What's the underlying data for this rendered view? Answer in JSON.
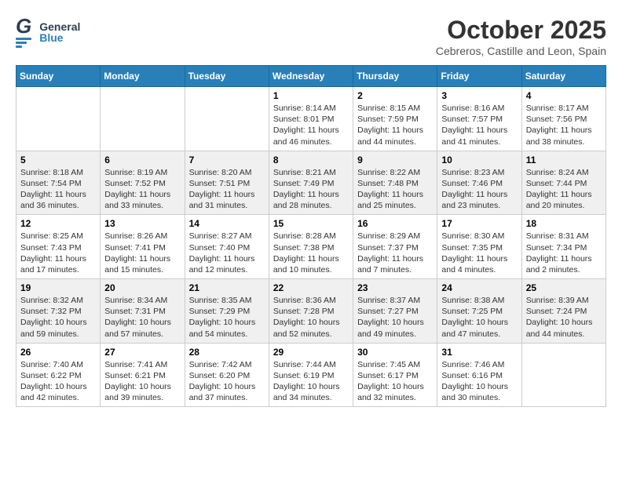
{
  "header": {
    "logo_general": "General",
    "logo_blue": "Blue",
    "month": "October 2025",
    "location": "Cebreros, Castille and Leon, Spain"
  },
  "weekdays": [
    "Sunday",
    "Monday",
    "Tuesday",
    "Wednesday",
    "Thursday",
    "Friday",
    "Saturday"
  ],
  "weeks": [
    [
      {
        "day": "",
        "info": ""
      },
      {
        "day": "",
        "info": ""
      },
      {
        "day": "",
        "info": ""
      },
      {
        "day": "1",
        "info": "Sunrise: 8:14 AM\nSunset: 8:01 PM\nDaylight: 11 hours\nand 46 minutes."
      },
      {
        "day": "2",
        "info": "Sunrise: 8:15 AM\nSunset: 7:59 PM\nDaylight: 11 hours\nand 44 minutes."
      },
      {
        "day": "3",
        "info": "Sunrise: 8:16 AM\nSunset: 7:57 PM\nDaylight: 11 hours\nand 41 minutes."
      },
      {
        "day": "4",
        "info": "Sunrise: 8:17 AM\nSunset: 7:56 PM\nDaylight: 11 hours\nand 38 minutes."
      }
    ],
    [
      {
        "day": "5",
        "info": "Sunrise: 8:18 AM\nSunset: 7:54 PM\nDaylight: 11 hours\nand 36 minutes."
      },
      {
        "day": "6",
        "info": "Sunrise: 8:19 AM\nSunset: 7:52 PM\nDaylight: 11 hours\nand 33 minutes."
      },
      {
        "day": "7",
        "info": "Sunrise: 8:20 AM\nSunset: 7:51 PM\nDaylight: 11 hours\nand 31 minutes."
      },
      {
        "day": "8",
        "info": "Sunrise: 8:21 AM\nSunset: 7:49 PM\nDaylight: 11 hours\nand 28 minutes."
      },
      {
        "day": "9",
        "info": "Sunrise: 8:22 AM\nSunset: 7:48 PM\nDaylight: 11 hours\nand 25 minutes."
      },
      {
        "day": "10",
        "info": "Sunrise: 8:23 AM\nSunset: 7:46 PM\nDaylight: 11 hours\nand 23 minutes."
      },
      {
        "day": "11",
        "info": "Sunrise: 8:24 AM\nSunset: 7:44 PM\nDaylight: 11 hours\nand 20 minutes."
      }
    ],
    [
      {
        "day": "12",
        "info": "Sunrise: 8:25 AM\nSunset: 7:43 PM\nDaylight: 11 hours\nand 17 minutes."
      },
      {
        "day": "13",
        "info": "Sunrise: 8:26 AM\nSunset: 7:41 PM\nDaylight: 11 hours\nand 15 minutes."
      },
      {
        "day": "14",
        "info": "Sunrise: 8:27 AM\nSunset: 7:40 PM\nDaylight: 11 hours\nand 12 minutes."
      },
      {
        "day": "15",
        "info": "Sunrise: 8:28 AM\nSunset: 7:38 PM\nDaylight: 11 hours\nand 10 minutes."
      },
      {
        "day": "16",
        "info": "Sunrise: 8:29 AM\nSunset: 7:37 PM\nDaylight: 11 hours\nand 7 minutes."
      },
      {
        "day": "17",
        "info": "Sunrise: 8:30 AM\nSunset: 7:35 PM\nDaylight: 11 hours\nand 4 minutes."
      },
      {
        "day": "18",
        "info": "Sunrise: 8:31 AM\nSunset: 7:34 PM\nDaylight: 11 hours\nand 2 minutes."
      }
    ],
    [
      {
        "day": "19",
        "info": "Sunrise: 8:32 AM\nSunset: 7:32 PM\nDaylight: 10 hours\nand 59 minutes."
      },
      {
        "day": "20",
        "info": "Sunrise: 8:34 AM\nSunset: 7:31 PM\nDaylight: 10 hours\nand 57 minutes."
      },
      {
        "day": "21",
        "info": "Sunrise: 8:35 AM\nSunset: 7:29 PM\nDaylight: 10 hours\nand 54 minutes."
      },
      {
        "day": "22",
        "info": "Sunrise: 8:36 AM\nSunset: 7:28 PM\nDaylight: 10 hours\nand 52 minutes."
      },
      {
        "day": "23",
        "info": "Sunrise: 8:37 AM\nSunset: 7:27 PM\nDaylight: 10 hours\nand 49 minutes."
      },
      {
        "day": "24",
        "info": "Sunrise: 8:38 AM\nSunset: 7:25 PM\nDaylight: 10 hours\nand 47 minutes."
      },
      {
        "day": "25",
        "info": "Sunrise: 8:39 AM\nSunset: 7:24 PM\nDaylight: 10 hours\nand 44 minutes."
      }
    ],
    [
      {
        "day": "26",
        "info": "Sunrise: 7:40 AM\nSunset: 6:22 PM\nDaylight: 10 hours\nand 42 minutes."
      },
      {
        "day": "27",
        "info": "Sunrise: 7:41 AM\nSunset: 6:21 PM\nDaylight: 10 hours\nand 39 minutes."
      },
      {
        "day": "28",
        "info": "Sunrise: 7:42 AM\nSunset: 6:20 PM\nDaylight: 10 hours\nand 37 minutes."
      },
      {
        "day": "29",
        "info": "Sunrise: 7:44 AM\nSunset: 6:19 PM\nDaylight: 10 hours\nand 34 minutes."
      },
      {
        "day": "30",
        "info": "Sunrise: 7:45 AM\nSunset: 6:17 PM\nDaylight: 10 hours\nand 32 minutes."
      },
      {
        "day": "31",
        "info": "Sunrise: 7:46 AM\nSunset: 6:16 PM\nDaylight: 10 hours\nand 30 minutes."
      },
      {
        "day": "",
        "info": ""
      }
    ]
  ]
}
